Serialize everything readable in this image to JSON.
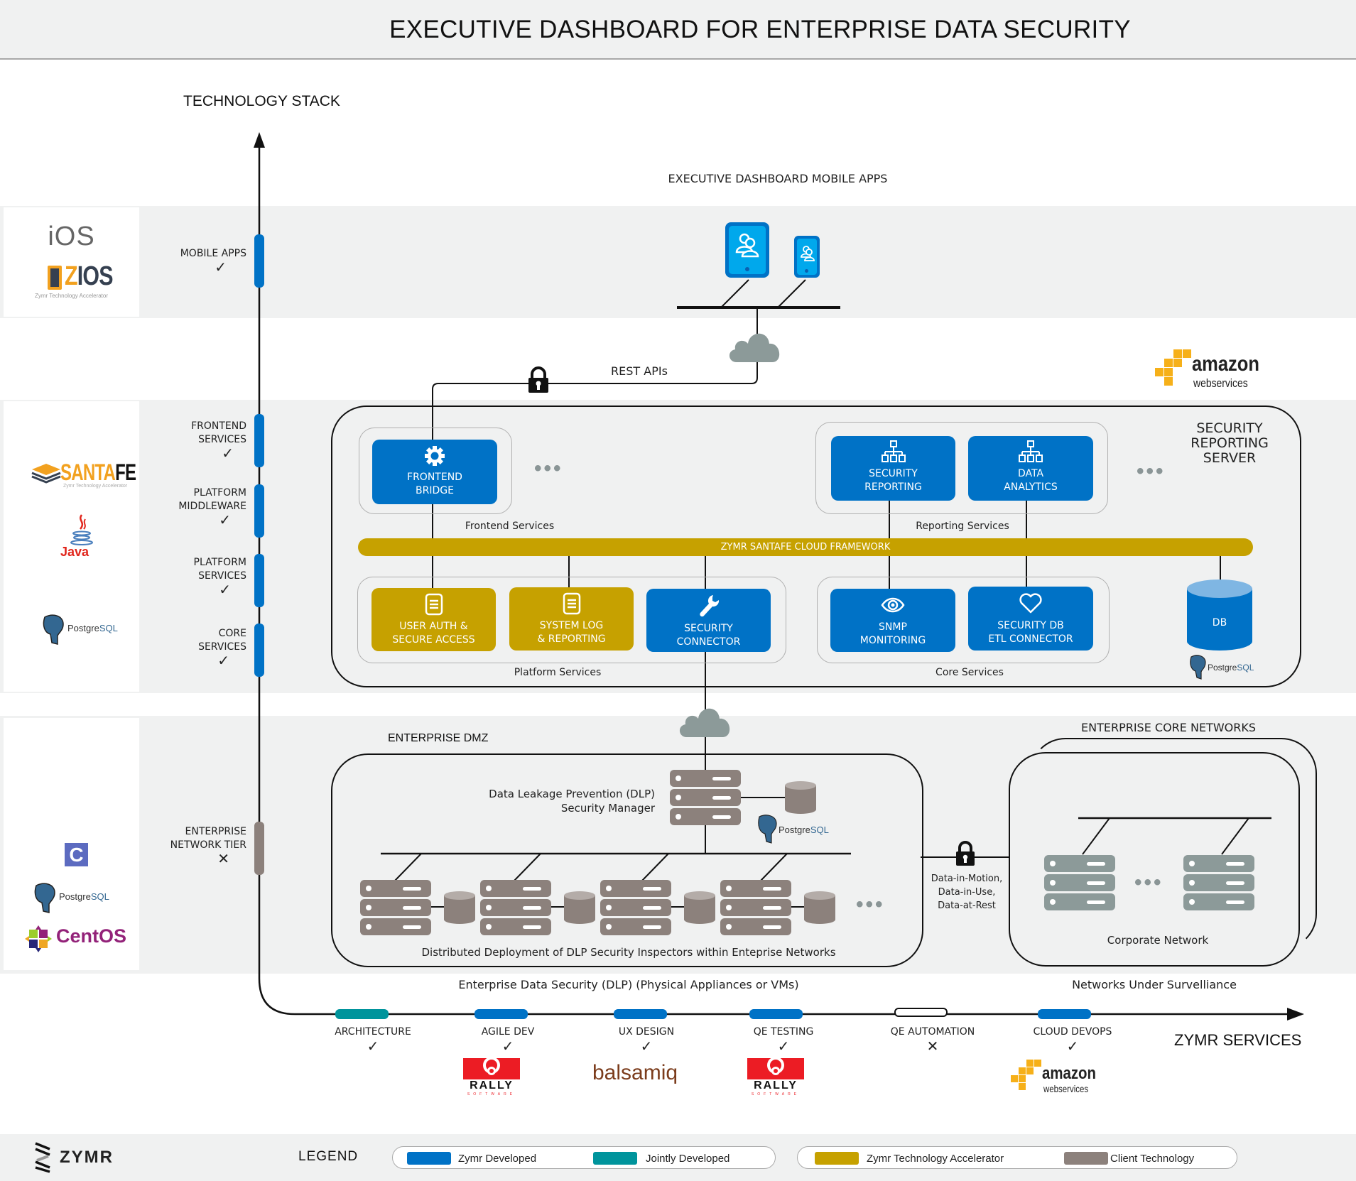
{
  "header": {
    "title": "EXECUTIVE DASHBOARD FOR ENTERPRISE DATA SECURITY"
  },
  "axes": {
    "vertical_label": "TECHNOLOGY STACK",
    "horizontal_label": "ZYMR SERVICES"
  },
  "colors": {
    "zymr_developed": "#0072c6",
    "jointly_developed": "#00949c",
    "technology_accelerator": "#c6a100",
    "client_technology": "#8c817c",
    "band_bg": "#f0f1f1"
  },
  "stack_tiers": [
    {
      "label_lines": [
        "MOBILE APPS"
      ],
      "status": "check",
      "owner": "zymr_developed"
    },
    {
      "label_lines": [
        "FRONTEND",
        "SERVICES"
      ],
      "status": "check",
      "owner": "zymr_developed"
    },
    {
      "label_lines": [
        "PLATFORM",
        "MIDDLEWARE"
      ],
      "status": "check",
      "owner": "zymr_developed"
    },
    {
      "label_lines": [
        "PLATFORM",
        "SERVICES"
      ],
      "status": "check",
      "owner": "zymr_developed"
    },
    {
      "label_lines": [
        "CORE",
        "SERVICES"
      ],
      "status": "check",
      "owner": "zymr_developed"
    },
    {
      "label_lines": [
        "ENTERPRISE",
        "NETWORK TIER"
      ],
      "status": "cross",
      "owner": "client_technology"
    }
  ],
  "logos": {
    "ios": "iOS",
    "zios": "ZIOS",
    "zios_sub": "Zymr Technology Accelerator",
    "santafe_a": "SANTA",
    "santafe_b": "FE",
    "santafe_sub": "Zymr Technology Accelerator",
    "java": "Java",
    "postgres_a": "Postgre",
    "postgres_b": "SQL",
    "c_lang": "C",
    "centos": "CentOS",
    "aws_a": "amazon",
    "aws_b": "webservices",
    "rally": "RALLY",
    "rally_sub": "SOFTWARE",
    "balsamiq": "balsamiq"
  },
  "mobile": {
    "title": "EXECUTIVE DASHBOARD MOBILE APPS",
    "rest_label": "REST APIs"
  },
  "server": {
    "title_lines": [
      "SECURITY",
      "REPORTING",
      "SERVER"
    ],
    "framework": "ZYMR SANTAFE CLOUD FRAMEWORK",
    "groups": {
      "frontend": "Frontend Services",
      "reporting": "Reporting Services",
      "platform": "Platform Services",
      "core": "Core Services"
    },
    "modules": {
      "frontend_bridge": [
        "FRONTEND",
        "BRIDGE"
      ],
      "security_reporting": [
        "SECURITY",
        "REPORTING"
      ],
      "data_analytics": [
        "DATA",
        "ANALYTICS"
      ],
      "user_auth": [
        "USER AUTH &",
        "SECURE ACCESS"
      ],
      "system_log": [
        "SYSTEM LOG",
        "& REPORTING"
      ],
      "security_connector": [
        "SECURITY",
        "CONNECTOR"
      ],
      "snmp": [
        "SNMP",
        "MONITORING"
      ],
      "etl": [
        "SECURITY DB",
        "ETL CONNECTOR"
      ]
    },
    "db_label": "DB"
  },
  "enterprise": {
    "dmz_title": "ENTERPRISE DMZ",
    "dlp_manager_lines": [
      "Data Leakage Prevention (DLP)",
      "Security Manager"
    ],
    "inspectors_caption": "Distributed Deployment of DLP Security Inspectors within Enteprise Networks",
    "dlp_caption": "Enterprise Data Security (DLP) (Physical Appliances or VMs)",
    "data_states": [
      "Data-in-Motion,",
      "Data-in-Use,",
      "Data-at-Rest"
    ],
    "core_title": "ENTERPRISE CORE NETWORKS",
    "corporate_label": "Corporate Network",
    "surveillance_caption": "Networks Under Survelliance"
  },
  "services": [
    {
      "label": "ARCHITECTURE",
      "status": "check",
      "owner": "jointly_developed"
    },
    {
      "label": "AGILE DEV",
      "status": "check",
      "owner": "zymr_developed",
      "tool": "rally"
    },
    {
      "label": "UX DESIGN",
      "status": "check",
      "owner": "zymr_developed",
      "tool": "balsamiq"
    },
    {
      "label": "QE TESTING",
      "status": "check",
      "owner": "zymr_developed",
      "tool": "rally"
    },
    {
      "label": "QE AUTOMATION",
      "status": "cross",
      "owner": "none"
    },
    {
      "label": "CLOUD DEVOPS",
      "status": "check",
      "owner": "zymr_developed",
      "tool": "aws"
    }
  ],
  "footer": {
    "brand": "ZYMR",
    "legend_title": "LEGEND",
    "legend": [
      {
        "label": "Zymr Developed",
        "color": "#0072c6"
      },
      {
        "label": "Jointly Developed",
        "color": "#00949c"
      },
      {
        "label": "Zymr Technology Accelerator",
        "color": "#c6a100"
      },
      {
        "label": "Client Technology",
        "color": "#8c817c"
      }
    ]
  }
}
